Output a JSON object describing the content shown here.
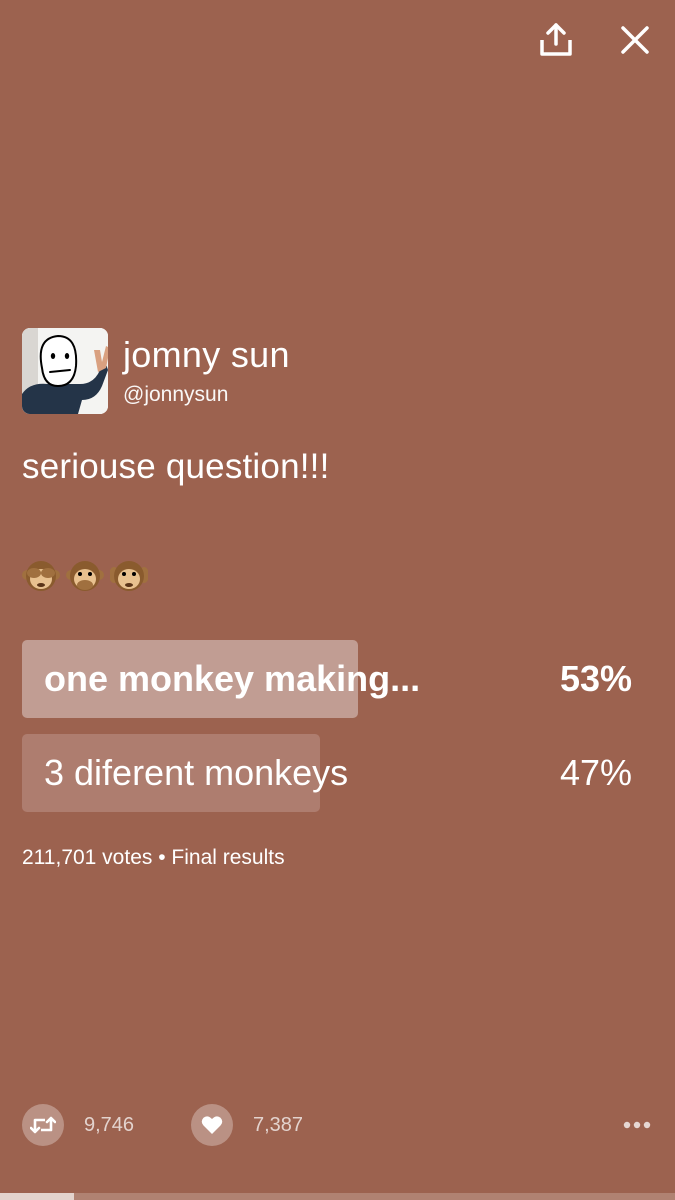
{
  "header": {
    "share_icon": "share-upload-icon",
    "close_icon": "close-x-icon"
  },
  "author": {
    "display_name": "jomny sun",
    "handle": "@jonnysun",
    "avatar_icon": "profile-photo-drawn-face"
  },
  "tweet": {
    "text": "seriouse question!!!",
    "emojis": [
      "see-no-evil-monkey",
      "speak-no-evil-monkey",
      "hear-no-evil-monkey"
    ]
  },
  "poll": {
    "options": [
      {
        "label": "one monkey making...",
        "percent_label": "53%",
        "percent": 53
      },
      {
        "label": "3 diferent monkeys",
        "percent_label": "47%",
        "percent": 47
      }
    ],
    "meta": "211,701 votes • Final results"
  },
  "actions": {
    "retweet_count": "9,746",
    "like_count": "7,387",
    "retweet_icon": "retweet-icon",
    "like_icon": "heart-icon",
    "more_icon": "more-dots-icon"
  },
  "progress": {
    "fraction": 0.11
  },
  "colors": {
    "background": "#9c624f",
    "poll_winner": "#c19d93",
    "poll_loser": "#ae7d6f",
    "text": "#ffffff"
  }
}
